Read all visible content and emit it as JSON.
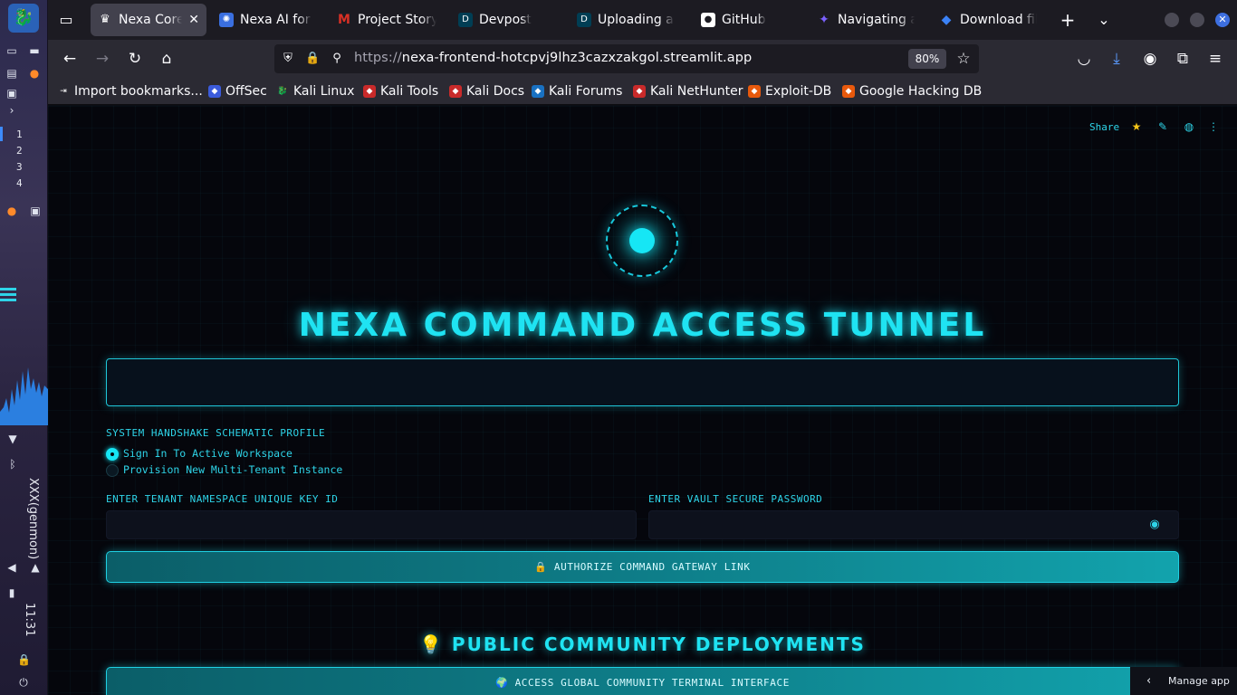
{
  "system": {
    "workspaces": [
      "1",
      "2",
      "3",
      "4"
    ],
    "user": "XXX(genmon)",
    "clock": "11:31"
  },
  "browser": {
    "tabs": [
      {
        "label": "Nexa Core Command",
        "icon": "crown-icon",
        "color": "#42414d",
        "active": true
      },
      {
        "label": "Nexa AI for Real",
        "icon": "gear-icon",
        "color": "#3a6fe0"
      },
      {
        "label": "Project Story",
        "icon": "gmail-icon",
        "color": "#d93025"
      },
      {
        "label": "Devpost",
        "icon": "devpost-icon",
        "color": "#003e54"
      },
      {
        "label": "Uploading a document",
        "icon": "devpost-icon",
        "color": "#003e54"
      },
      {
        "label": "GitHub",
        "icon": "github-icon",
        "color": "#ffffff"
      },
      {
        "label": "Navigating a Streamlit",
        "icon": "sparkle-icon",
        "color": "#7b61ff"
      },
      {
        "label": "Download files",
        "icon": "gem-icon",
        "color": "#3b82f6"
      }
    ],
    "url": {
      "proto": "https://",
      "host": "nexa-frontend-hotcpvj9lhz3cazxzakgol.streamlit.app"
    },
    "zoom": "80%",
    "bookmarks": [
      {
        "label": "Import bookmarks...",
        "icon": "import-icon",
        "color": "#2b2a33"
      },
      {
        "label": "OffSec",
        "icon": "offsec-icon",
        "color": "#3b5bdb"
      },
      {
        "label": "Kali Linux",
        "icon": "kali-icon",
        "color": "#2b2a33"
      },
      {
        "label": "Kali Tools",
        "icon": "kali-tools-icon",
        "color": "#c92a2a"
      },
      {
        "label": "Kali Docs",
        "icon": "kali-docs-icon",
        "color": "#c92a2a"
      },
      {
        "label": "Kali Forums",
        "icon": "kali-forums-icon",
        "color": "#1971c2"
      },
      {
        "label": "Kali NetHunter",
        "icon": "nethunter-icon",
        "color": "#c92a2a"
      },
      {
        "label": "Exploit-DB",
        "icon": "exploitdb-icon",
        "color": "#e8590c"
      },
      {
        "label": "Google Hacking DB",
        "icon": "ghdb-icon",
        "color": "#e8590c"
      }
    ]
  },
  "app": {
    "toolbar": {
      "share": "Share"
    },
    "title": "NEXA COMMAND ACCESS TUNNEL",
    "handshake": {
      "label": "SYSTEM HANDSHAKE SCHEMATIC PROFILE",
      "options": [
        "Sign In To Active Workspace",
        "Provision New Multi-Tenant Instance"
      ],
      "selected": 0
    },
    "tenant_label": "ENTER TENANT NAMESPACE UNIQUE KEY ID",
    "password_label": "ENTER VAULT SECURE PASSWORD",
    "authorize_button": "🔒 AUTHORIZE COMMAND GATEWAY LINK",
    "community_title": "💡 PUBLIC COMMUNITY DEPLOYMENTS",
    "community_button": "🌍 ACCESS GLOBAL COMMUNITY TERMINAL INTERFACE",
    "manage_app": "Manage app",
    "accent": "#1fe3f2"
  }
}
